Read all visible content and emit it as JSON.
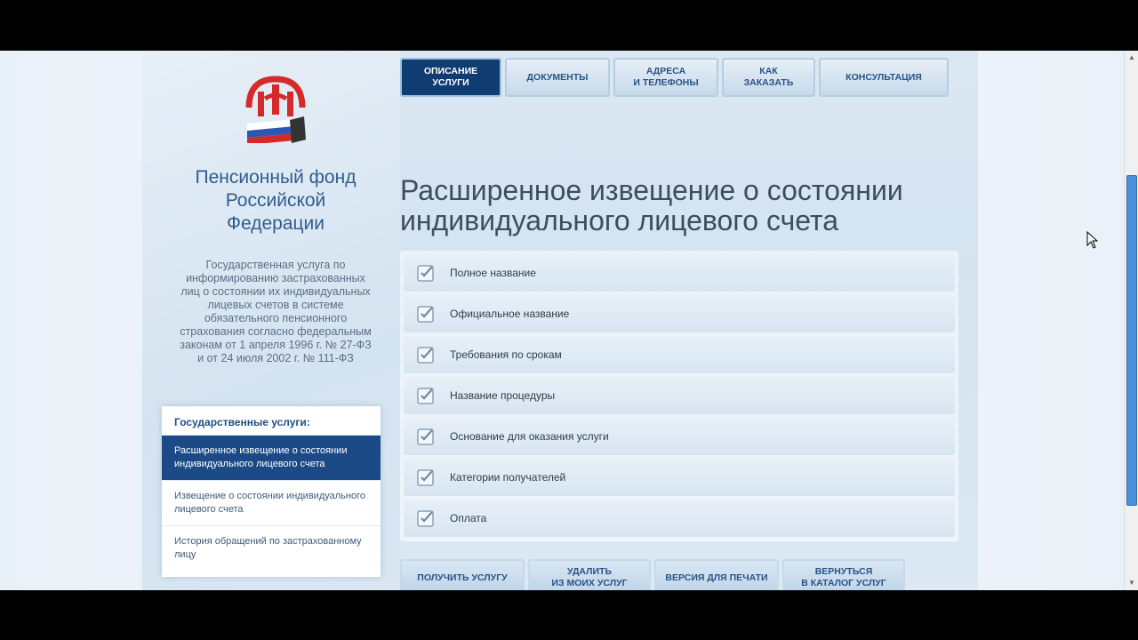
{
  "org": {
    "name_lines": [
      "Пенсионный фонд",
      "Российской",
      "Федерации"
    ],
    "description": "Государственная услуга по информированию застрахованных лиц о состоянии их индивидуальных лицевых счетов в системе обязательного пенсионного страхования согласно федеральным законам от 1 апреля 1996 г. № 27-ФЗ и от 24 июля 2002 г. № 111-ФЗ"
  },
  "sidebar": {
    "heading": "Государственные услуги:",
    "items": [
      {
        "label": "Расширенное извещение о состоянии индивидуального лицевого счета",
        "active": true
      },
      {
        "label": "Извещение о состоянии индивидуального лицевого счета",
        "active": false
      },
      {
        "label": "История обращений по застрахованному лицу",
        "active": false
      }
    ]
  },
  "tabs": [
    {
      "line1": "ОПИСАНИЕ",
      "line2": "УСЛУГИ",
      "active": true
    },
    {
      "line1": "ДОКУМЕНТЫ",
      "line2": "",
      "active": false
    },
    {
      "line1": "АДРЕСА",
      "line2": "И ТЕЛЕФОНЫ",
      "active": false
    },
    {
      "line1": "КАК",
      "line2": "ЗАКАЗАТЬ",
      "active": false
    },
    {
      "line1": "КОНСУЛЬТАЦИЯ",
      "line2": "",
      "active": false
    }
  ],
  "main": {
    "title": "Расширенное извещение о состоянии индивидуального лицевого счета",
    "sections": [
      {
        "label": "Полное название",
        "icon": "checklist-icon"
      },
      {
        "label": "Официальное название",
        "icon": "checklist-icon"
      },
      {
        "label": "Требования по срокам",
        "icon": "checklist-icon"
      },
      {
        "label": "Название процедуры",
        "icon": "checklist-icon"
      },
      {
        "label": "Основание для оказания услуги",
        "icon": "checklist-icon"
      },
      {
        "label": "Категории получателей",
        "icon": "checklist-icon"
      },
      {
        "label": "Оплата",
        "icon": "checklist-icon"
      }
    ]
  },
  "actions": [
    {
      "line1": "ПОЛУЧИТЬ УСЛУГУ",
      "line2": ""
    },
    {
      "line1": "УДАЛИТЬ",
      "line2": "ИЗ МОИХ УСЛУГ"
    },
    {
      "line1": "ВЕРСИЯ ДЛЯ ПЕЧАТИ",
      "line2": ""
    },
    {
      "line1": "ВЕРНУТЬСЯ",
      "line2": "В КАТАЛОГ УСЛУГ"
    }
  ],
  "colors": {
    "accent": "#0f3c73",
    "active_item": "#1b4a86",
    "title_blue": "#2f5d8f"
  }
}
